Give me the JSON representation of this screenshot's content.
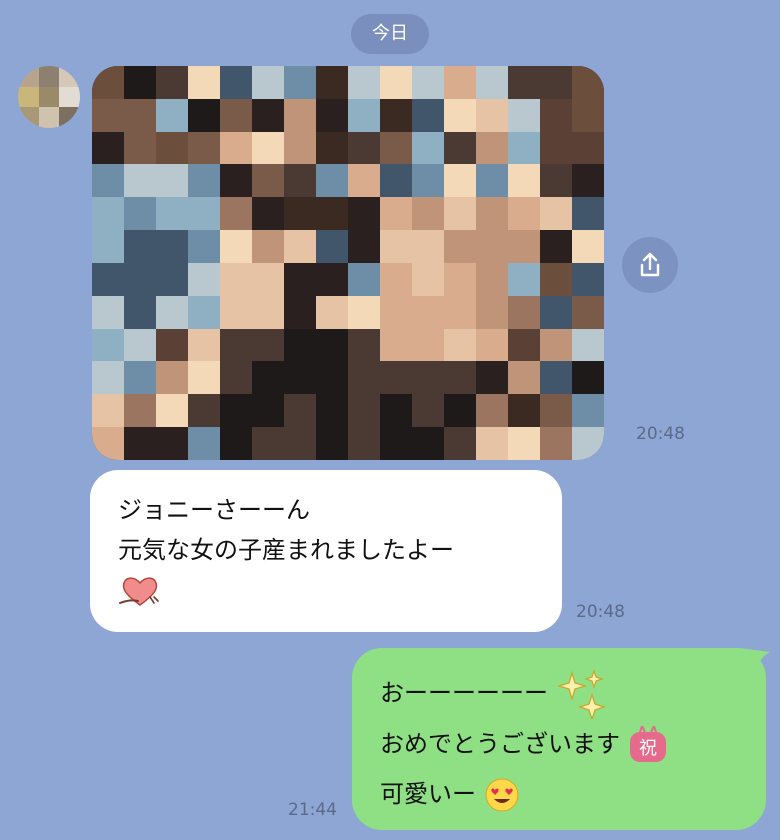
{
  "date_divider": "今日",
  "photo_message": {
    "time": "20:48"
  },
  "incoming": {
    "lines": [
      "ジョニーさーーん",
      "元気な女の子産まれましたよー"
    ],
    "time": "20:48"
  },
  "outgoing": {
    "line1": "おーーーーーー",
    "line2": "おめでとうございます",
    "line3": "可愛いー",
    "time": "21:44"
  },
  "icons": {
    "share": "share-icon",
    "heart": "heart-emoji-icon",
    "sparkles": "sparkles-icon",
    "celebrate": "iwai-sticker-icon",
    "smile": "heart-eyes-emoji-icon"
  },
  "colors": {
    "background": "#8ea6d4",
    "incoming_bubble": "#ffffff",
    "outgoing_bubble": "#8fe085"
  }
}
